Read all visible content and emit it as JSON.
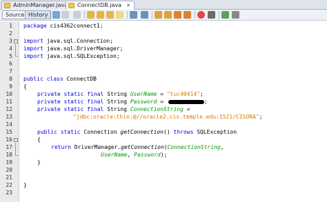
{
  "tabs": [
    {
      "label": "AdminManager.java",
      "active": false
    },
    {
      "label": "ConnectDB.java",
      "active": true
    }
  ],
  "toolbar": {
    "source_label": "Source",
    "history_label": "History"
  },
  "line_numbers": [
    "1",
    "2",
    "3",
    "4",
    "5",
    "6",
    "7",
    "8",
    "9",
    "10",
    "11",
    "12",
    "13",
    "14",
    "15",
    "16",
    "17",
    "18",
    "19",
    "20",
    "21",
    "22",
    "23"
  ],
  "code": {
    "l1_kw": "package",
    "l1_rest": " cis4362connect1;",
    "l3_kw": "import",
    "l3_rest": " java.sql.Connection;",
    "l4_kw": "import",
    "l4_rest": " java.sql.DriverManager;",
    "l5_kw": "import",
    "l5_rest": " java.sql.SQLException;",
    "l8_kw": "public class",
    "l8_rest": " ConnectDB",
    "l9": "{",
    "l10_kw": "private static final",
    "l10_type": " String ",
    "l10_field": "UserName",
    "l10_eq": " = ",
    "l10_str": "\"tuc40414\"",
    "l10_end": ";",
    "l11_kw": "private static final",
    "l11_type": " String ",
    "l11_field": "Password",
    "l11_eq": " = ",
    "l11_end": ";",
    "l12_kw": "private static final",
    "l12_type": " String ",
    "l12_field": "ConnectionString",
    "l12_eq": " =",
    "l13_str": "\"jdbc:oracle:thin:@//oracle2.cis.temple.edu:1521/CISORA\"",
    "l13_end": ";",
    "l15_kw": "public static",
    "l15_type": " Connection ",
    "l15_method": "getConnection",
    "l15_mid": "() ",
    "l15_kw2": "throws",
    "l15_rest": " SQLException",
    "l16": "{",
    "l17_kw": "return",
    "l17_mid": " DriverManager.",
    "l17_method": "getConnection",
    "l17_paren": "(",
    "l17_field": "ConnectionString",
    "l17_comma": ",",
    "l18_field1": "UserName",
    "l18_comma": ", ",
    "l18_field2": "Password",
    "l18_end": ");",
    "l19": "}",
    "l22": "}"
  },
  "icons": {
    "tab_file": "java-file-icon",
    "close": "close-icon"
  }
}
